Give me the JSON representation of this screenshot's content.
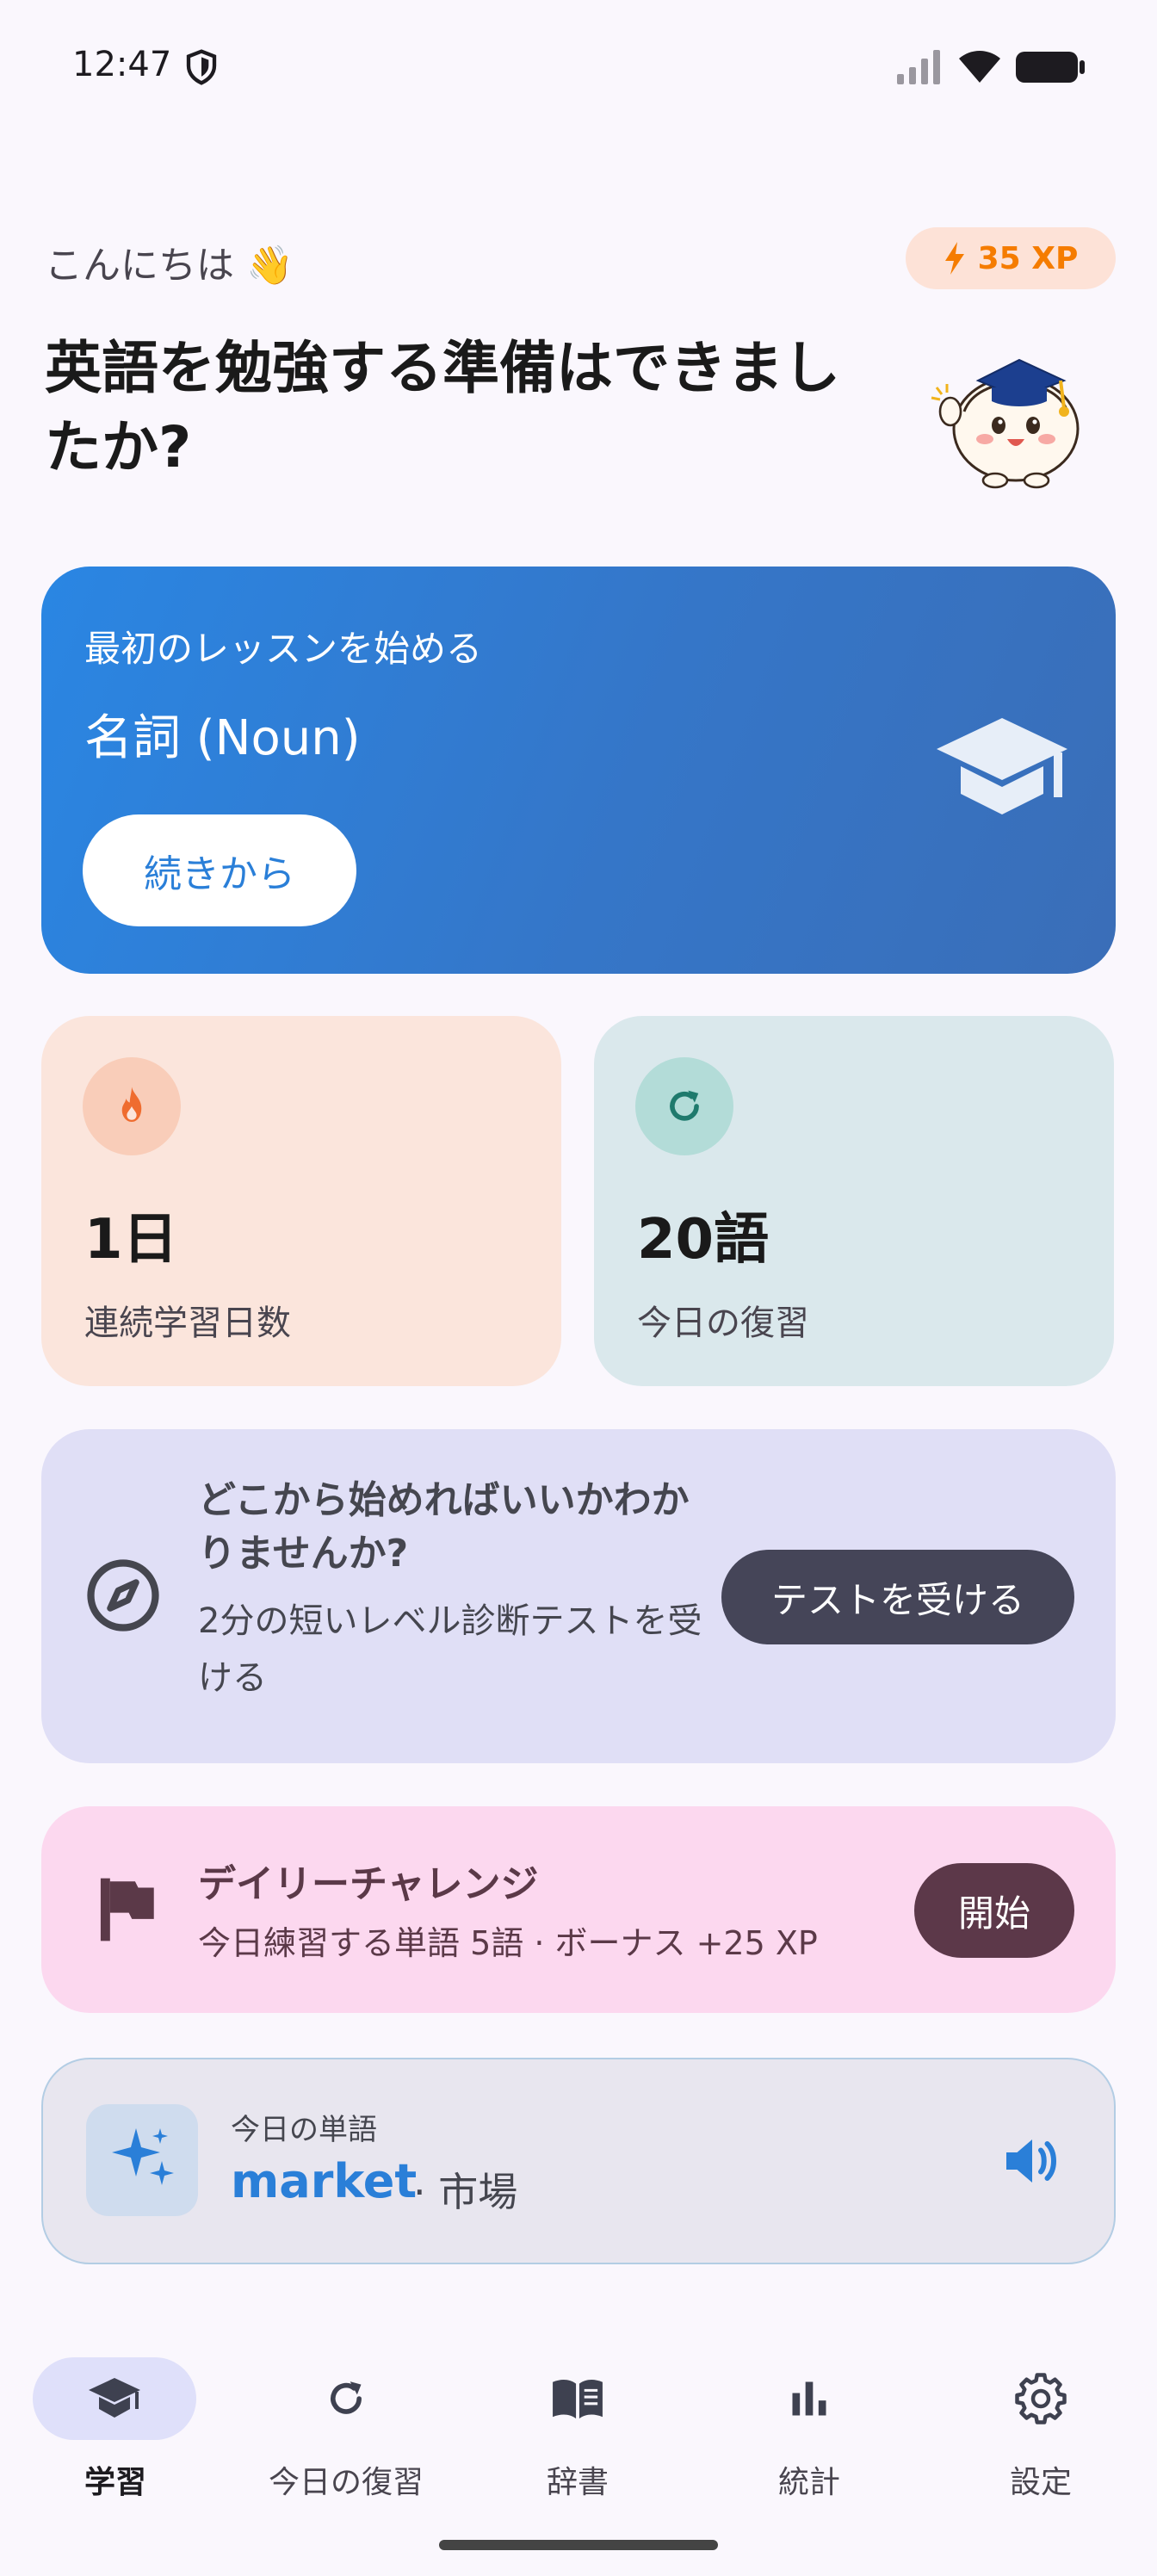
{
  "status_bar": {
    "time": "12:47"
  },
  "header": {
    "greeting": "こんにちは 👋",
    "xp_label": "35 XP",
    "headline": "英語を勉強する準備はできましたか?"
  },
  "lesson_card": {
    "kicker": "最初のレッスンを始める",
    "title": "名詞 (Noun)",
    "button_label": "続きから"
  },
  "stats": {
    "streak": {
      "value": "1日",
      "label": "連続学習日数"
    },
    "review": {
      "value": "20語",
      "label": "今日の復習"
    }
  },
  "diagnostic": {
    "title": "どこから始めればいいかわかりませんか?",
    "description": "2分の短いレベル診断テストを受ける",
    "button_label": "テストを受ける"
  },
  "daily_challenge": {
    "title": "デイリーチャレンジ",
    "description": "今日練習する単語 5語 · ボーナス +25 XP",
    "button_label": "開始"
  },
  "word_of_day": {
    "kicker": "今日の単語",
    "word": "market",
    "translation": "· 市場"
  },
  "bottom_nav": {
    "items": [
      {
        "label": "学習",
        "icon": "graduation-cap-icon",
        "active": true
      },
      {
        "label": "今日の復習",
        "icon": "refresh-icon",
        "active": false
      },
      {
        "label": "辞書",
        "icon": "book-icon",
        "active": false
      },
      {
        "label": "統計",
        "icon": "bar-chart-icon",
        "active": false
      },
      {
        "label": "設定",
        "icon": "gear-icon",
        "active": false
      }
    ]
  },
  "colors": {
    "accent_blue": "#2a7fd8",
    "xp_orange": "#f57c00",
    "streak_bg": "#fbe5dc",
    "review_bg": "#dae8ec",
    "diagnostic_bg": "#e0dff6",
    "challenge_bg": "#fcd8ef"
  }
}
